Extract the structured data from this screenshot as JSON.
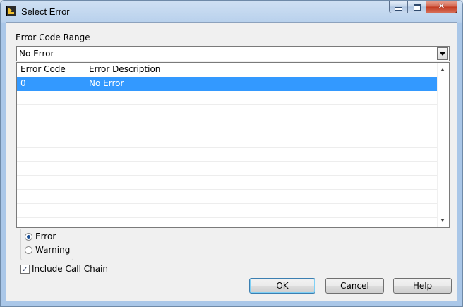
{
  "window": {
    "title": "Select Error",
    "icon": "labview-app-icon",
    "controls": {
      "minimize": "minimize-icon",
      "maximize": "maximize-icon",
      "close": "✕"
    }
  },
  "error_code_range": {
    "label": "Error Code Range",
    "selected": "No Error"
  },
  "table": {
    "columns": [
      "Error Code",
      "Error Description"
    ],
    "rows": [
      {
        "code": "0",
        "description": "No Error",
        "selected": true
      }
    ],
    "empty_row_count": 10
  },
  "type_options": {
    "options": [
      "Error",
      "Warning"
    ],
    "selected": "Error"
  },
  "include_call_chain": {
    "label": "Include Call Chain",
    "checked": true,
    "mark": "✓"
  },
  "buttons": {
    "ok": "OK",
    "cancel": "Cancel",
    "help": "Help"
  },
  "colors": {
    "selection": "#3399ff",
    "window_frame": "#aac7e8",
    "close_button": "#c2391f"
  }
}
